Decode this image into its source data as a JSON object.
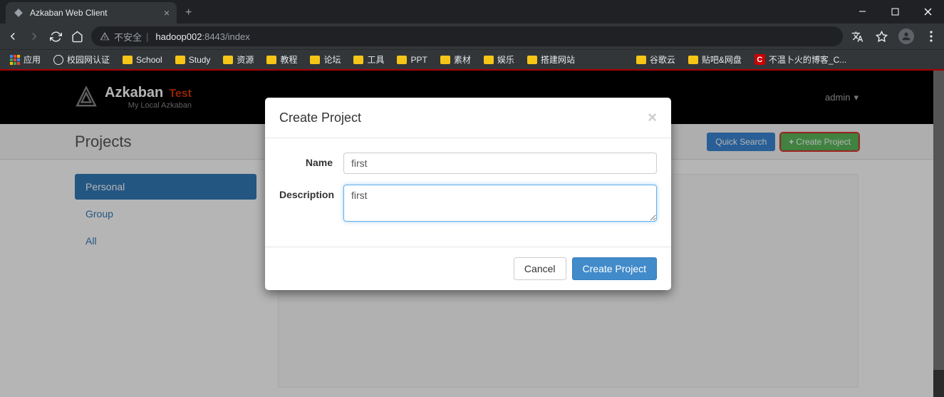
{
  "browser": {
    "tab_title": "Azkaban Web Client",
    "url_insecure_label": "不安全",
    "url_host": "hadoop002",
    "url_path": ":8443/index"
  },
  "bookmarks": [
    {
      "label": "应用",
      "type": "apps"
    },
    {
      "label": "校园网认证",
      "type": "globe"
    },
    {
      "label": "School",
      "type": "folder"
    },
    {
      "label": "Study",
      "type": "folder"
    },
    {
      "label": "资源",
      "type": "folder"
    },
    {
      "label": "教程",
      "type": "folder"
    },
    {
      "label": "论坛",
      "type": "folder"
    },
    {
      "label": "工具",
      "type": "folder"
    },
    {
      "label": "PPT",
      "type": "folder"
    },
    {
      "label": "素材",
      "type": "folder"
    },
    {
      "label": "娱乐",
      "type": "folder"
    },
    {
      "label": "搭建网站",
      "type": "folder"
    },
    {
      "label": "",
      "type": "blank"
    },
    {
      "label": "谷歌云",
      "type": "folder"
    },
    {
      "label": "贴吧&网盘",
      "type": "folder"
    },
    {
      "label": "不温卜火的博客_C...",
      "type": "red-c"
    }
  ],
  "brand": {
    "name": "Azkaban",
    "badge": "Test",
    "subtitle": "My Local Azkaban"
  },
  "nav": {
    "user": "admin"
  },
  "page": {
    "title": "Projects",
    "quick_search": "Quick Search",
    "create_project": "Create Project"
  },
  "sidebar": {
    "items": [
      {
        "label": "Personal",
        "active": true
      },
      {
        "label": "Group",
        "active": false
      },
      {
        "label": "All",
        "active": false
      }
    ]
  },
  "modal": {
    "title": "Create Project",
    "name_label": "Name",
    "name_value": "first",
    "description_label": "Description",
    "description_value": "first",
    "cancel": "Cancel",
    "submit": "Create Project"
  }
}
